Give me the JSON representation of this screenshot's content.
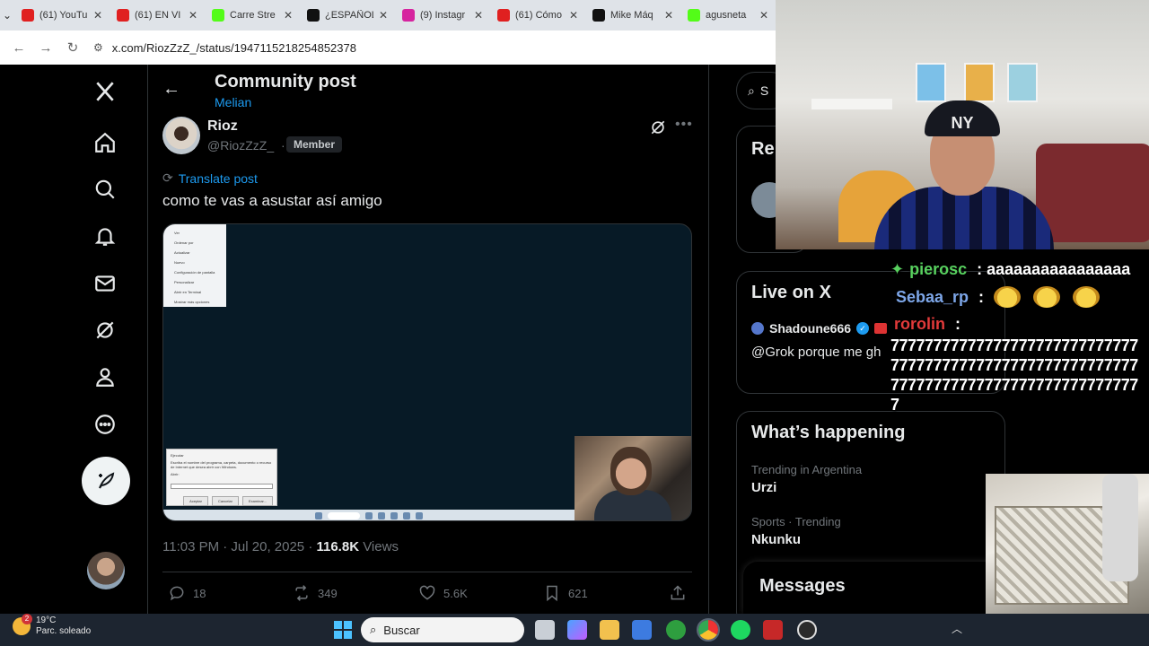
{
  "browser": {
    "tabs": [
      {
        "title": "(61) YouTu",
        "favicon": "youtube-icon",
        "color": "#e02020"
      },
      {
        "title": "(61) EN VI",
        "favicon": "youtube-icon",
        "color": "#e02020"
      },
      {
        "title": "Carre Stre",
        "favicon": "kick-icon",
        "color": "#53fc18"
      },
      {
        "title": "¿ESPAÑOL",
        "favicon": "tiktok-icon",
        "color": "#111111"
      },
      {
        "title": "(9) Instagr",
        "favicon": "instagram-icon",
        "color": "#d6249f"
      },
      {
        "title": "(61) Cómo",
        "favicon": "youtube-icon",
        "color": "#e02020"
      },
      {
        "title": "Mike Máq",
        "favicon": "tiktok-icon",
        "color": "#111111"
      },
      {
        "title": "agusneta",
        "favicon": "kick-icon",
        "color": "#53fc18"
      }
    ],
    "url": "x.com/RiozZzZ_/status/1947115218254852378"
  },
  "header": {
    "title": "Community post",
    "subtitle": "Melian"
  },
  "post": {
    "author_name": "Rioz",
    "author_handle": "@RiozZzZ_",
    "separator": "·",
    "badge": "Member",
    "translate": "Translate post",
    "text": "como te vas a asustar así amigo",
    "timestamp": "11:03 PM · Jul 20, 2025 · ",
    "views_count": "116.8K",
    "views_label": " Views",
    "media": {
      "context_menu": [
        "Ver",
        "Ordenar por",
        "Actualizar",
        "Nuevo",
        "Configuración de pantalla",
        "Personalizar",
        "Abrir en Terminal",
        "Mostrar más opciones"
      ],
      "run_dialog_title": "Ejecutar",
      "run_dialog_text": "Escriba el nombre del programa, carpeta, documento o recurso de Internet que desea abrir con Windows.",
      "run_dialog_label": "Abrir:",
      "run_dialog_buttons": [
        "Aceptar",
        "Cancelar",
        "Examinar..."
      ]
    },
    "actions": {
      "replies": "18",
      "reposts": "349",
      "likes": "5.6K",
      "bookmarks": "621"
    }
  },
  "right": {
    "search_placeholder": "S",
    "relevant_title": "Re",
    "live_title": "Live on X",
    "live_host": "Shadoune666",
    "live_text": "@Grok porque me gh",
    "happening_title": "What’s happening",
    "trends": [
      {
        "category": "Trending in Argentina",
        "name": "Urzi"
      },
      {
        "category": "Sports · Trending",
        "name": "Nkunku"
      }
    ],
    "messages": "Messages"
  },
  "chat": [
    {
      "user": "pierosc",
      "sep": " : ",
      "text": "aaaaaaaaaaaaaaaa"
    },
    {
      "user": "Sebaa_rp",
      "sep": " : ",
      "text": ""
    },
    {
      "user": "rorolin",
      "sep": " :",
      "text": "7777777777777777777777777777777777777777777777777777777777777777777777777777777777777777"
    }
  ],
  "webcam": {
    "cap_logo": "NY"
  },
  "taskbar": {
    "temperature": "19°C",
    "weather": "Parc. soleado",
    "weather_badge": "2",
    "search": "Buscar"
  },
  "colors": {
    "x_blue": "#1d9bf0",
    "bg": "#000000",
    "border": "#2f3336",
    "muted": "#71767b"
  }
}
